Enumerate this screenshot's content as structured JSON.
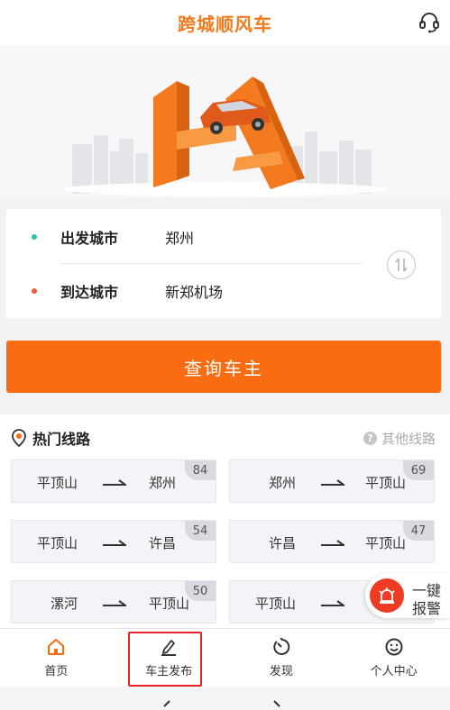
{
  "header": {
    "title": "跨城顺风车",
    "service_icon": "customer-service-headset-icon"
  },
  "colors": {
    "accent": "#fa6c12",
    "title": "#f37a1f",
    "alarm": "#ee3b24",
    "highlight": "#e52323"
  },
  "route_form": {
    "departure_label": "出发城市",
    "departure_value": "郑州",
    "arrival_label": "到达城市",
    "arrival_value": "新郑机场"
  },
  "search_button": "查询车主",
  "hot_routes": {
    "title": "热门线路",
    "other_link": "其他线路",
    "routes": [
      {
        "from": "平顶山",
        "to": "郑州",
        "count": "84"
      },
      {
        "from": "郑州",
        "to": "平顶山",
        "count": "69"
      },
      {
        "from": "平顶山",
        "to": "许昌",
        "count": "54"
      },
      {
        "from": "许昌",
        "to": "平顶山",
        "count": "47"
      },
      {
        "from": "漯河",
        "to": "平顶山",
        "count": "50"
      },
      {
        "from": "平顶山",
        "to": "",
        "count": ""
      }
    ]
  },
  "alarm": {
    "line1": "一键",
    "line2": "报警"
  },
  "tabs": [
    {
      "label": "首页",
      "icon": "home-icon"
    },
    {
      "label": "车主发布",
      "icon": "edit-pen-icon"
    },
    {
      "label": "发现",
      "icon": "discover-timer-icon"
    },
    {
      "label": "个人中心",
      "icon": "smiley-profile-icon"
    }
  ]
}
